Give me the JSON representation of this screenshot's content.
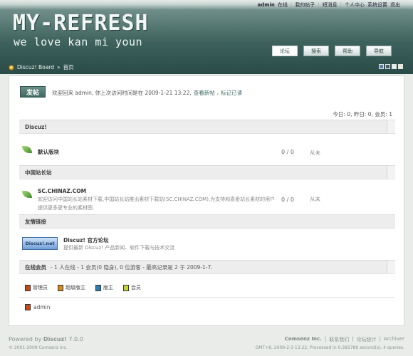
{
  "header": {
    "user": "admin",
    "top_links": [
      "在线",
      "我的帖子",
      "短消息",
      "个人中心",
      "系统设置",
      "退出"
    ],
    "logo_title": "MY-REFRESH",
    "logo_subtitle": "we love kan mi youn",
    "nav": [
      "论坛",
      "搜索",
      "帮助",
      "导航"
    ]
  },
  "breadcrumb": {
    "root": "Discuz! Board",
    "sep": "»",
    "current": "首页"
  },
  "theme_colors": [
    "#5b7fa8",
    "#445d6b",
    "#e7eef0",
    "#f0e9d0"
  ],
  "main": {
    "post_button": "发帖",
    "welcome_text": "欢迎回来 admin, 你上次访问时间是在 2009-1-21 13:22,",
    "welcome_link_new": "查看新帖",
    "welcome_link_read": "标记已读",
    "stats": "今日: 0, 昨日: 0, 会员: 1",
    "sections": [
      {
        "title": "Discuz!"
      },
      {
        "title": "中国站长站"
      },
      {
        "title": "友情链接"
      }
    ],
    "forums": [
      {
        "name": "默认版块",
        "desc": "",
        "count": "0 / 0",
        "last": "从未"
      },
      {
        "name": "SC.CHINAZ.COM",
        "desc": "欢迎访问中国站长站素材下载,中国站长站推出素材下载站(SC.CHINAZ.COM),为支持和喜爱站长素材的用户提供更多更专业的素材图.",
        "count": "0 / 0",
        "last": "从未"
      }
    ],
    "partner": {
      "logo_text": "Discuz!.net",
      "name": "Discuz! 官方论坛",
      "desc": "提供最新 Discuz! 产品新闻、软件下载与技术交流"
    },
    "online": {
      "label": "在线会员",
      "text": "- 1 人在线 - 1 会员(0 隐身), 0 位游客 - 最高记录是 2 于 2009-1-7."
    },
    "legend": [
      {
        "label": "管理员",
        "color": "#c44a1a"
      },
      {
        "label": "超级版主",
        "color": "#d48a1a"
      },
      {
        "label": "版主",
        "color": "#2a7fb0"
      },
      {
        "label": "会员",
        "color": "#c7d62a"
      }
    ],
    "online_user": "admin"
  },
  "footer": {
    "powered": "Powered by",
    "product": "Discuz!",
    "version": "7.0.0",
    "copyright": "© 2001-2009 Comsenz Inc.",
    "company": "Comsenz Inc.",
    "links": [
      "联系我们",
      "论坛统计",
      "Archiver"
    ],
    "info": "GMT+8, 2009-2-3 13:22, Processed in 0.383789 second(s), 4 queries."
  }
}
